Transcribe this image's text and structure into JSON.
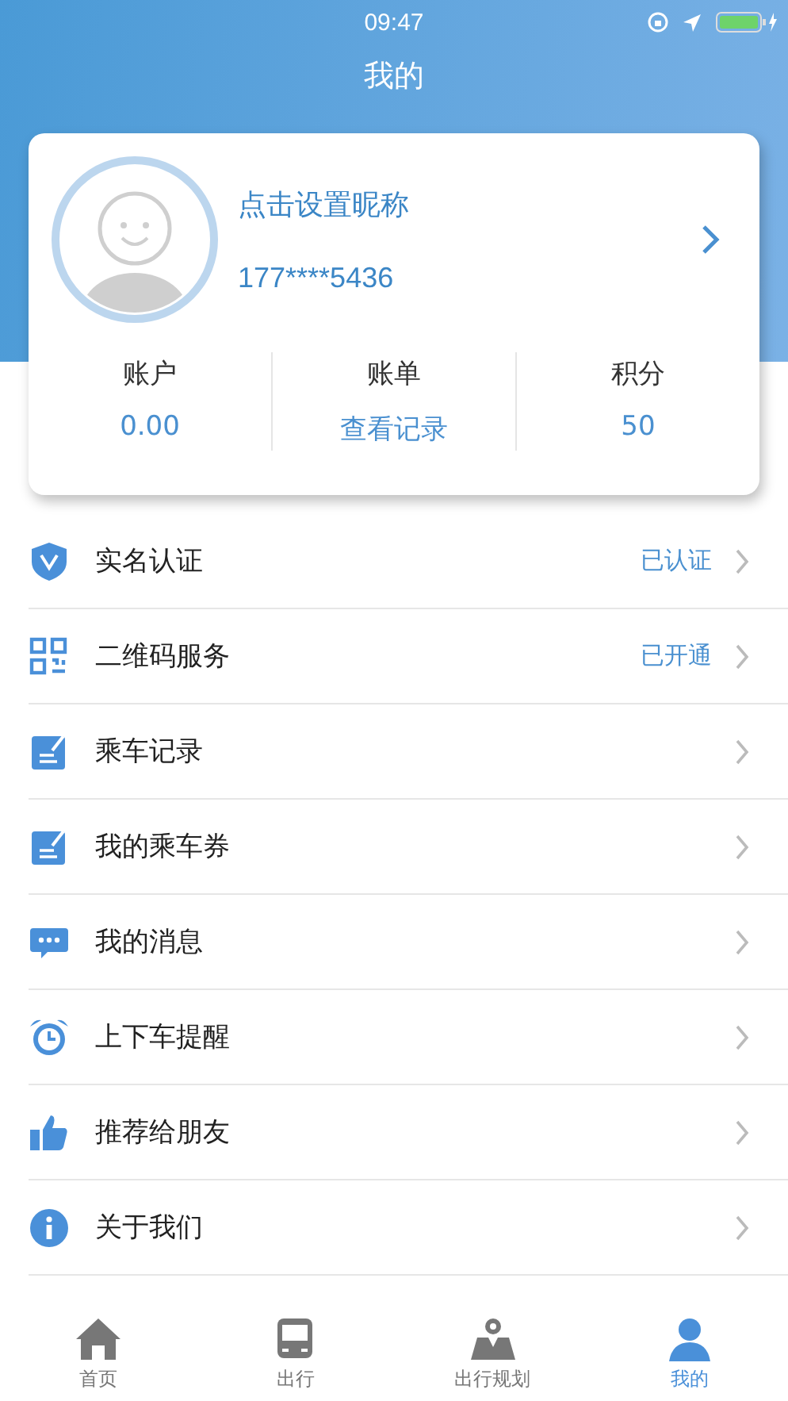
{
  "status_bar": {
    "time": "09:47"
  },
  "title": "我的",
  "profile": {
    "nickname": "点击设置昵称",
    "phone": "177****5436"
  },
  "stats": [
    {
      "label": "账户",
      "value": "0.00"
    },
    {
      "label": "账单",
      "value": "查看记录"
    },
    {
      "label": "积分",
      "value": "50"
    }
  ],
  "menu": [
    {
      "kind": "shield",
      "label": "实名认证",
      "status": "已认证"
    },
    {
      "kind": "qr",
      "label": "二维码服务",
      "status": "已开通"
    },
    {
      "kind": "note",
      "label": "乘车记录"
    },
    {
      "kind": "note",
      "label": "我的乘车券"
    },
    {
      "kind": "chat",
      "label": "我的消息"
    },
    {
      "kind": "alarm",
      "label": "上下车提醒"
    },
    {
      "kind": "thumb",
      "label": "推荐给朋友"
    },
    {
      "kind": "info",
      "label": "关于我们"
    }
  ],
  "tabs": [
    {
      "kind": "home",
      "label": "首页",
      "selected": false
    },
    {
      "kind": "bus",
      "label": "出行",
      "selected": false
    },
    {
      "kind": "map",
      "label": "出行规划",
      "selected": false
    },
    {
      "kind": "person",
      "label": "我的",
      "selected": true
    }
  ]
}
